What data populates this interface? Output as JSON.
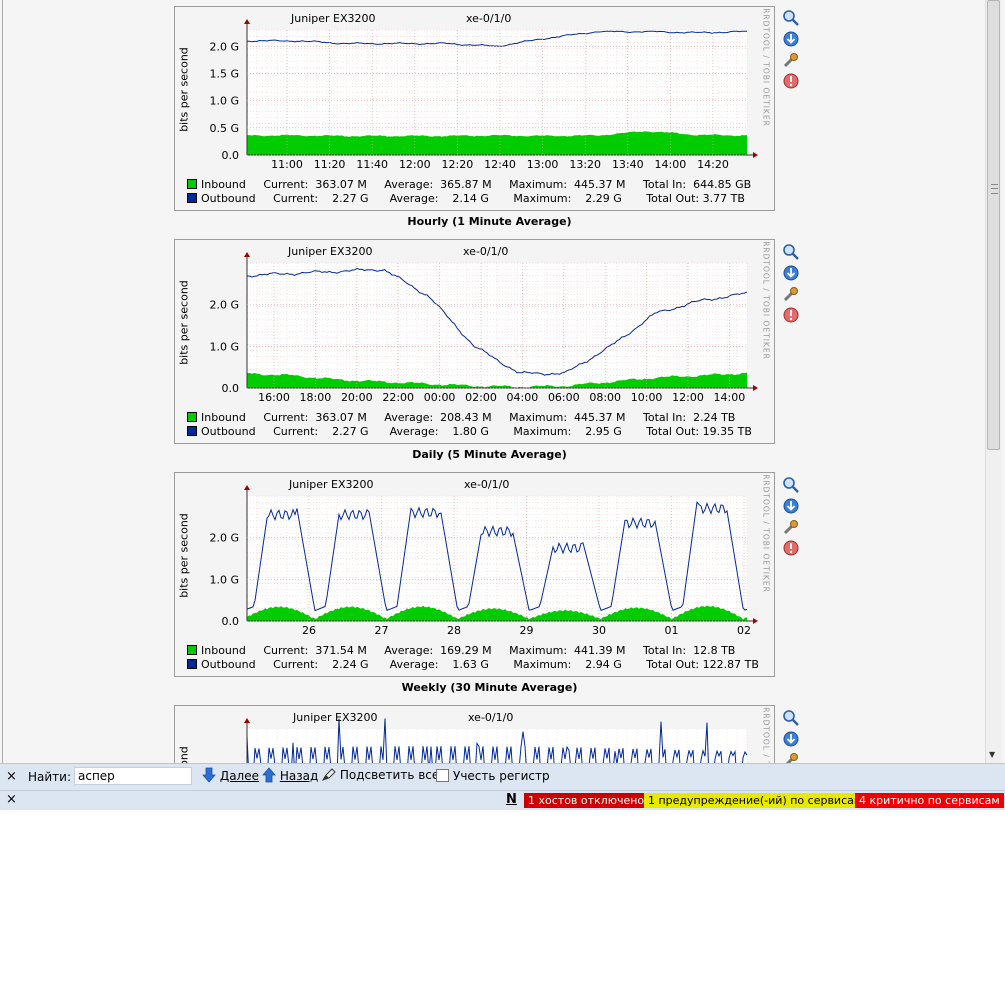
{
  "graphs": [
    {
      "host": "Juniper EX3200",
      "iface": "xe-0/1/0",
      "ylabel": "bits per second",
      "watermark": "RRDTOOL / TOBI OETIKER",
      "caption": "Hourly (1 Minute Average)",
      "inbound": "Inbound     Current:  363.07 M     Average:  365.87 M     Maximum:  445.37 M     Total In:  644.85 GB",
      "outbound": "Outbound     Current:    2.27 G      Average:    2.14 G       Maximum:    2.29 G       Total Out: 3.77 TB"
    },
    {
      "host": "Juniper EX3200",
      "iface": "xe-0/1/0",
      "ylabel": "bits per second",
      "watermark": "RRDTOOL / TOBI OETIKER",
      "caption": "Daily (5 Minute Average)",
      "inbound": "Inbound     Current:  363.07 M     Average:  208.43 M     Maximum:  445.37 M     Total In:  2.24 TB",
      "outbound": "Outbound     Current:    2.27 G      Average:    1.80 G       Maximum:    2.95 G       Total Out: 19.35 TB"
    },
    {
      "host": "Juniper EX3200",
      "iface": "xe-0/1/0",
      "ylabel": "bits per second",
      "watermark": "RRDTOOL / TOBI OETIKER",
      "caption": "Weekly (30 Minute Average)",
      "inbound": "Inbound     Current:  371.54 M     Average:  169.29 M     Maximum:  441.39 M     Total In:  12.8 TB",
      "outbound": "Outbound     Current:    2.24 G      Average:    1.63 G       Maximum:    2.94 G       Total Out: 122.87 TB"
    },
    {
      "host": "Juniper EX3200",
      "iface": "xe-0/1/0",
      "ylabel": "bits per second",
      "watermark": "RRDTOOL / TOBI OETIKER",
      "caption": "",
      "inbound": "",
      "outbound": ""
    }
  ],
  "chart_data": [
    {
      "type": "area",
      "title": "Juniper EX3200    xe-0/1/0",
      "ylabel": "bits per second",
      "ylim": [
        0,
        2.3
      ],
      "yticks": [
        "0.0",
        "0.5 G",
        "1.0 G",
        "1.5 G",
        "2.0 G"
      ],
      "x": [
        "11:00",
        "11:20",
        "11:40",
        "12:00",
        "12:20",
        "12:40",
        "13:00",
        "13:20",
        "13:40",
        "14:00",
        "14:20"
      ],
      "series": [
        {
          "name": "Inbound",
          "values": [
            0.36,
            0.36,
            0.35,
            0.35,
            0.35,
            0.36,
            0.35,
            0.36,
            0.44,
            0.37,
            0.36
          ]
        },
        {
          "name": "Outbound",
          "values": [
            2.1,
            2.1,
            2.05,
            2.05,
            2.05,
            2.0,
            2.15,
            2.27,
            2.27,
            2.25,
            2.27
          ]
        }
      ]
    },
    {
      "type": "area",
      "title": "Juniper EX3200    xe-0/1/0",
      "ylabel": "bits per second",
      "ylim": [
        0,
        3.0
      ],
      "yticks": [
        "0.0",
        "1.0 G",
        "2.0 G"
      ],
      "x": [
        "16:00",
        "18:00",
        "20:00",
        "22:00",
        "00:00",
        "02:00",
        "04:00",
        "06:00",
        "08:00",
        "10:00",
        "12:00",
        "14:00"
      ],
      "series": [
        {
          "name": "Inbound",
          "values": [
            0.35,
            0.3,
            0.2,
            0.15,
            0.1,
            0.05,
            0.03,
            0.05,
            0.15,
            0.25,
            0.3,
            0.36
          ]
        },
        {
          "name": "Outbound",
          "values": [
            2.7,
            2.75,
            2.8,
            2.85,
            2.2,
            1.0,
            0.35,
            0.35,
            1.0,
            1.8,
            2.1,
            2.27
          ]
        }
      ]
    },
    {
      "type": "area",
      "title": "Juniper EX3200    xe-0/1/0",
      "ylabel": "bits per second",
      "ylim": [
        0,
        3.0
      ],
      "yticks": [
        "0.0",
        "1.0 G",
        "2.0 G"
      ],
      "x": [
        "26",
        "27",
        "28",
        "29",
        "30",
        "01",
        "02"
      ],
      "series": [
        {
          "name": "Inbound",
          "values": [
            0.35,
            0.35,
            0.3,
            0.15,
            0.1,
            0.4,
            0.37
          ]
        },
        {
          "name": "Outbound",
          "values": [
            2.6,
            2.7,
            2.4,
            1.9,
            2.4,
            2.85,
            2.24
          ]
        }
      ]
    }
  ],
  "findbar": {
    "close": "×",
    "label": "Найти:",
    "value": "аспер",
    "next": "Далее",
    "prev": "Назад",
    "highlight": "Подсветить все",
    "match_case": "Учесть регистр"
  },
  "statusbar": {
    "close": "×",
    "nagios": "N",
    "hosts_down": "1 хостов отключено",
    "warnings": "1 предупреждение(-ий) по сервисам",
    "critical": "4 критично по сервисам",
    "colors": {
      "hosts_down": "#cc0000",
      "warnings": "#e8e800",
      "critical": "#ee0000"
    }
  }
}
